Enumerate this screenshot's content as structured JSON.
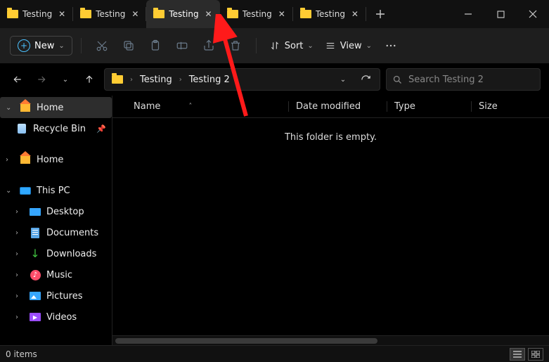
{
  "tabs": [
    {
      "label": "Testing",
      "active": false
    },
    {
      "label": "Testing",
      "active": false
    },
    {
      "label": "Testing",
      "active": true
    },
    {
      "label": "Testing",
      "active": false
    },
    {
      "label": "Testing",
      "active": false
    }
  ],
  "toolbar": {
    "new_label": "New",
    "sort_label": "Sort",
    "view_label": "View"
  },
  "breadcrumb": [
    "Testing",
    "Testing 2"
  ],
  "search": {
    "placeholder": "Search Testing 2"
  },
  "sidebar": {
    "home": "Home",
    "recycle": "Recycle Bin",
    "home2": "Home",
    "thispc": "This PC",
    "items": [
      "Desktop",
      "Documents",
      "Downloads",
      "Music",
      "Pictures",
      "Videos"
    ]
  },
  "columns": [
    "Name",
    "Date modified",
    "Type",
    "Size"
  ],
  "empty_text": "This folder is empty.",
  "status": "0 items"
}
